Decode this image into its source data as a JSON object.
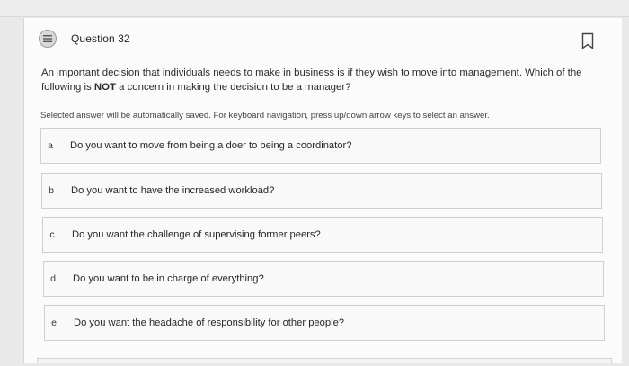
{
  "question": {
    "title": "Question 32",
    "icon": "list-question-icon",
    "bookmark_icon": "bookmark-icon",
    "text_before": "An important decision that individuals needs to make in business is if they wish to move into management.  Which of the following is ",
    "text_bold": "NOT",
    "text_after": " a concern in making the decision to be a manager?",
    "instructions": "Selected answer will be automatically saved. For keyboard navigation, press up/down arrow keys to select an answer."
  },
  "answers": [
    {
      "letter": "a",
      "text": "Do you want to move from being a doer to being a coordinator?"
    },
    {
      "letter": "b",
      "text": "Do you want to have the increased workload?"
    },
    {
      "letter": "c",
      "text": "Do you want the challenge of supervising former peers?"
    },
    {
      "letter": "d",
      "text": "Do you want to be in charge of everything?"
    },
    {
      "letter": "e",
      "text": "Do you want the headache of responsibility for other people?"
    }
  ],
  "colors": {
    "card_background": "#fbfbfb",
    "border": "#cfcfcf",
    "text": "#2b2b2b"
  }
}
